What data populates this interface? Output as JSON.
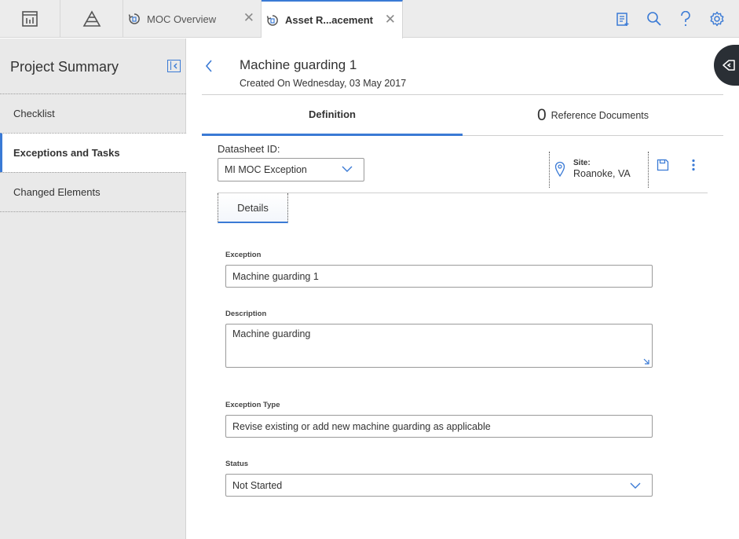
{
  "topbar": {
    "tabs": [
      {
        "label": "MOC Overview",
        "icon": "refresh-doc-icon"
      },
      {
        "label": "Asset R...acement",
        "icon": "refresh-doc-icon"
      }
    ],
    "left_icons": [
      "dashboard-icon",
      "pyramid-icon"
    ],
    "right_icons": [
      "clipboard-add-icon",
      "search-icon",
      "help-icon",
      "gear-icon"
    ]
  },
  "sidebar": {
    "title": "Project Summary",
    "items": [
      {
        "label": "Checklist",
        "active": false
      },
      {
        "label": "Exceptions and Tasks",
        "active": true
      },
      {
        "label": "Changed Elements",
        "active": false
      }
    ]
  },
  "record": {
    "title": "Machine guarding 1",
    "subtitle": "Created On Wednesday, 03 May 2017"
  },
  "tabs": {
    "definition_label": "Definition",
    "ref_count": "0",
    "ref_label": "Reference Documents"
  },
  "datasheet": {
    "label": "Datasheet ID:",
    "value": "MI MOC Exception"
  },
  "site": {
    "label": "Site:",
    "value": "Roanoke, VA"
  },
  "details_tab": "Details",
  "fields": {
    "exception": {
      "label": "Exception",
      "value": "Machine guarding 1"
    },
    "description": {
      "label": "Description",
      "value": "Machine guarding"
    },
    "exception_type": {
      "label": "Exception Type",
      "value": "Revise existing or add new machine guarding as applicable"
    },
    "status": {
      "label": "Status",
      "value": "Not Started"
    }
  },
  "colors": {
    "accent": "#3a7ad5",
    "sidebar_bg": "#e9e9e9",
    "topbar_bg": "#ececec"
  }
}
